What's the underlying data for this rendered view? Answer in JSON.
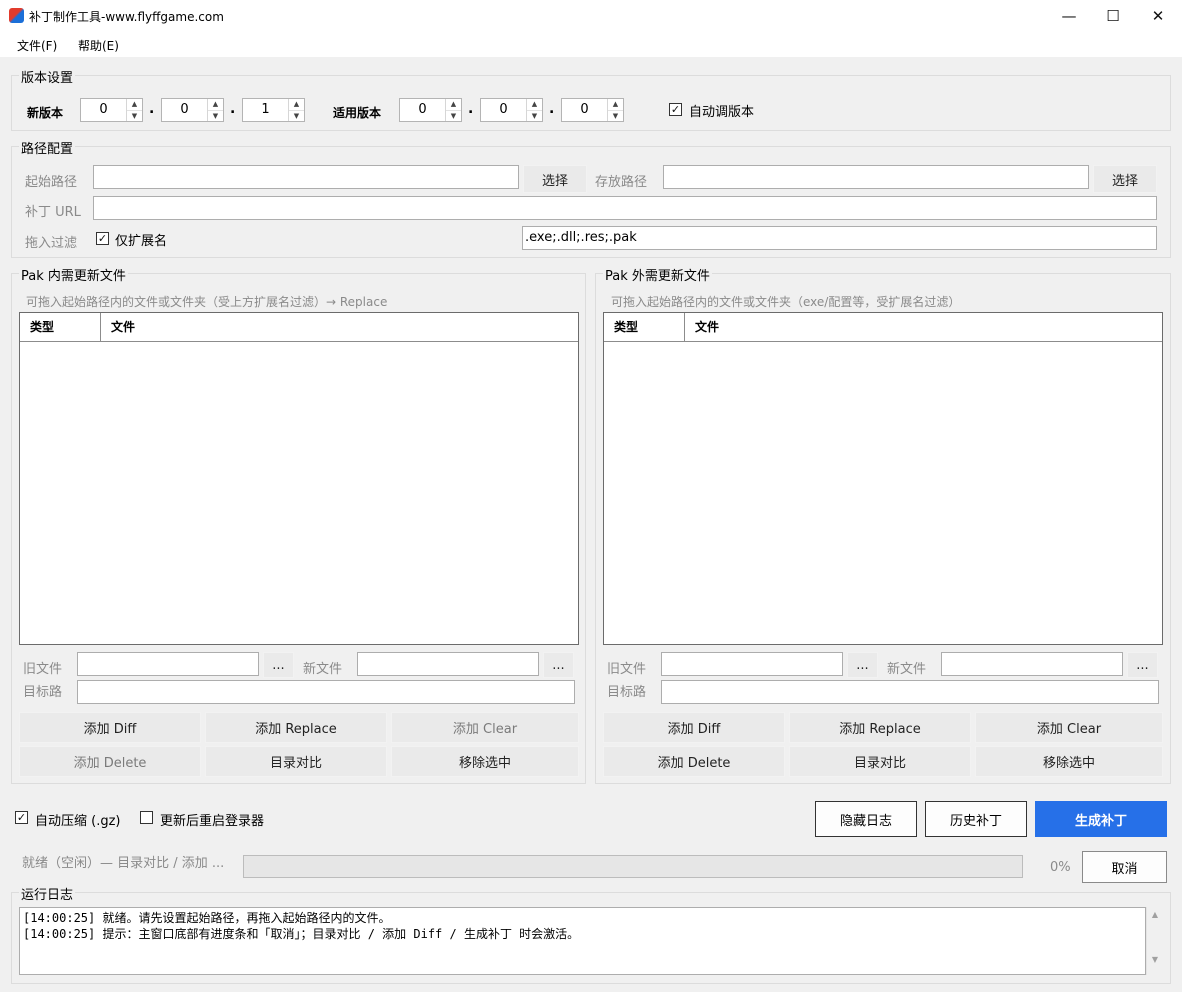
{
  "window": {
    "title": "补丁制作工具-www.flyffgame.com",
    "controls": {
      "minimize": "—",
      "maximize": "☐",
      "close": "✕"
    }
  },
  "menu": [
    "文件(F)",
    "帮助(E)"
  ],
  "version_group": {
    "title": "版本设置",
    "new_label": "新版本",
    "new_version": [
      "0",
      "0",
      "1"
    ],
    "applicable_label": "适用版本",
    "applicable_version": [
      "0",
      "0",
      "0"
    ],
    "separator": ".",
    "auto_label": "自动调版本",
    "auto_checked": true
  },
  "path_group": {
    "title": "路径配置",
    "start_label": "起始路径",
    "start_value": "",
    "select_label": "选择",
    "store_label": "存放路径",
    "store_value": "",
    "url_label": "补丁 URL",
    "url_value": "",
    "filter_label": "拖入过滤",
    "ext_only_label": "仅扩展名",
    "ext_only_checked": true,
    "ext_value": ".exe;.dll;.res;.pak"
  },
  "pak_in": {
    "title": "Pak 内需更新文件",
    "hint": "可拖入起始路径内的文件或文件夹（受上方扩展名过滤）→ Replace",
    "col_type": "类型",
    "col_file": "文件",
    "old_label": "旧文件",
    "new_label": "新文件",
    "target_label": "目标路",
    "browse": "...",
    "buttons": [
      "添加 Diff",
      "添加 Replace",
      "添加 Clear",
      "添加 Delete",
      "目录对比",
      "移除选中"
    ]
  },
  "pak_out": {
    "title": "Pak 外需更新文件",
    "hint": "可拖入起始路径内的文件或文件夹（exe/配置等，受扩展名过滤）",
    "col_type": "类型",
    "col_file": "文件",
    "old_label": "旧文件",
    "new_label": "新文件",
    "target_label": "目标路",
    "browse": "...",
    "buttons": [
      "添加 Diff",
      "添加 Replace",
      "添加 Clear",
      "添加 Delete",
      "目录对比",
      "移除选中"
    ]
  },
  "bottom": {
    "auto_compress_label": "自动压缩 (.gz)",
    "auto_compress_checked": true,
    "restart_label": "更新后重启登录器",
    "restart_checked": false,
    "hide_log": "隐藏日志",
    "history": "历史补丁",
    "generate": "生成补丁",
    "status": "就绪（空闲）— 目录对比 / 添加 ...",
    "progress_percent": 0,
    "progress_text": "0%",
    "cancel": "取消"
  },
  "log": {
    "title": "运行日志",
    "lines": [
      "[14:00:25] 就绪。请先设置起始路径，再拖入起始路径内的文件。",
      "[14:00:25] 提示：主窗口底部有进度条和「取消」；目录对比 / 添加 Diff / 生成补丁 时会激活。"
    ]
  },
  "colors": {
    "primary": "#2670e8",
    "background": "#f0f0f0"
  }
}
